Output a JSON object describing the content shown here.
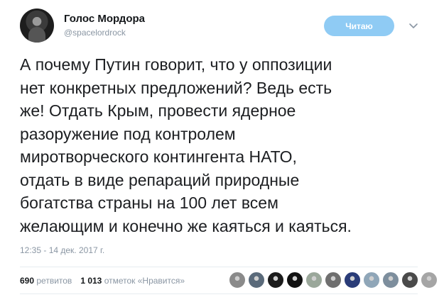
{
  "author": {
    "name": "Голос Мордора",
    "handle": "@spacelordrock"
  },
  "actions": {
    "follow_label": "Читаю",
    "menu_icon": "chevron-down-icon"
  },
  "tweet": {
    "text": "А почему Путин говорит, что у оппозиции\nнет конкретных предложений? Ведь есть\nже! Отдать Крым, провести ядерное\nразоружение под контролем\nмиротворческого контингента НАТО,\nотдать в виде репараций природные\nбогатства страны на 100 лет всем\nжелающим и конечно же каяться и каяться.",
    "timestamp": "12:35 - 14 дек. 2017 г."
  },
  "stats": {
    "retweets_count": "690",
    "retweets_label": "ретвитов",
    "likes_count": "1 013",
    "likes_label": "отметок «Нравится»"
  },
  "likers": [
    {
      "color": "#8a8a8a"
    },
    {
      "color": "#5a6a7a"
    },
    {
      "color": "#1b1b1b"
    },
    {
      "color": "#111111"
    },
    {
      "color": "#9aa79a"
    },
    {
      "color": "#6f6f6f"
    },
    {
      "color": "#2a3c78"
    },
    {
      "color": "#8fa6b8"
    },
    {
      "color": "#7d8e9d"
    },
    {
      "color": "#4a4a4a"
    },
    {
      "color": "#a5a5a5"
    }
  ],
  "colors": {
    "accent": "#1da1f2",
    "follow_bg": "#8fcbf4",
    "muted_text": "#8a96a3"
  }
}
